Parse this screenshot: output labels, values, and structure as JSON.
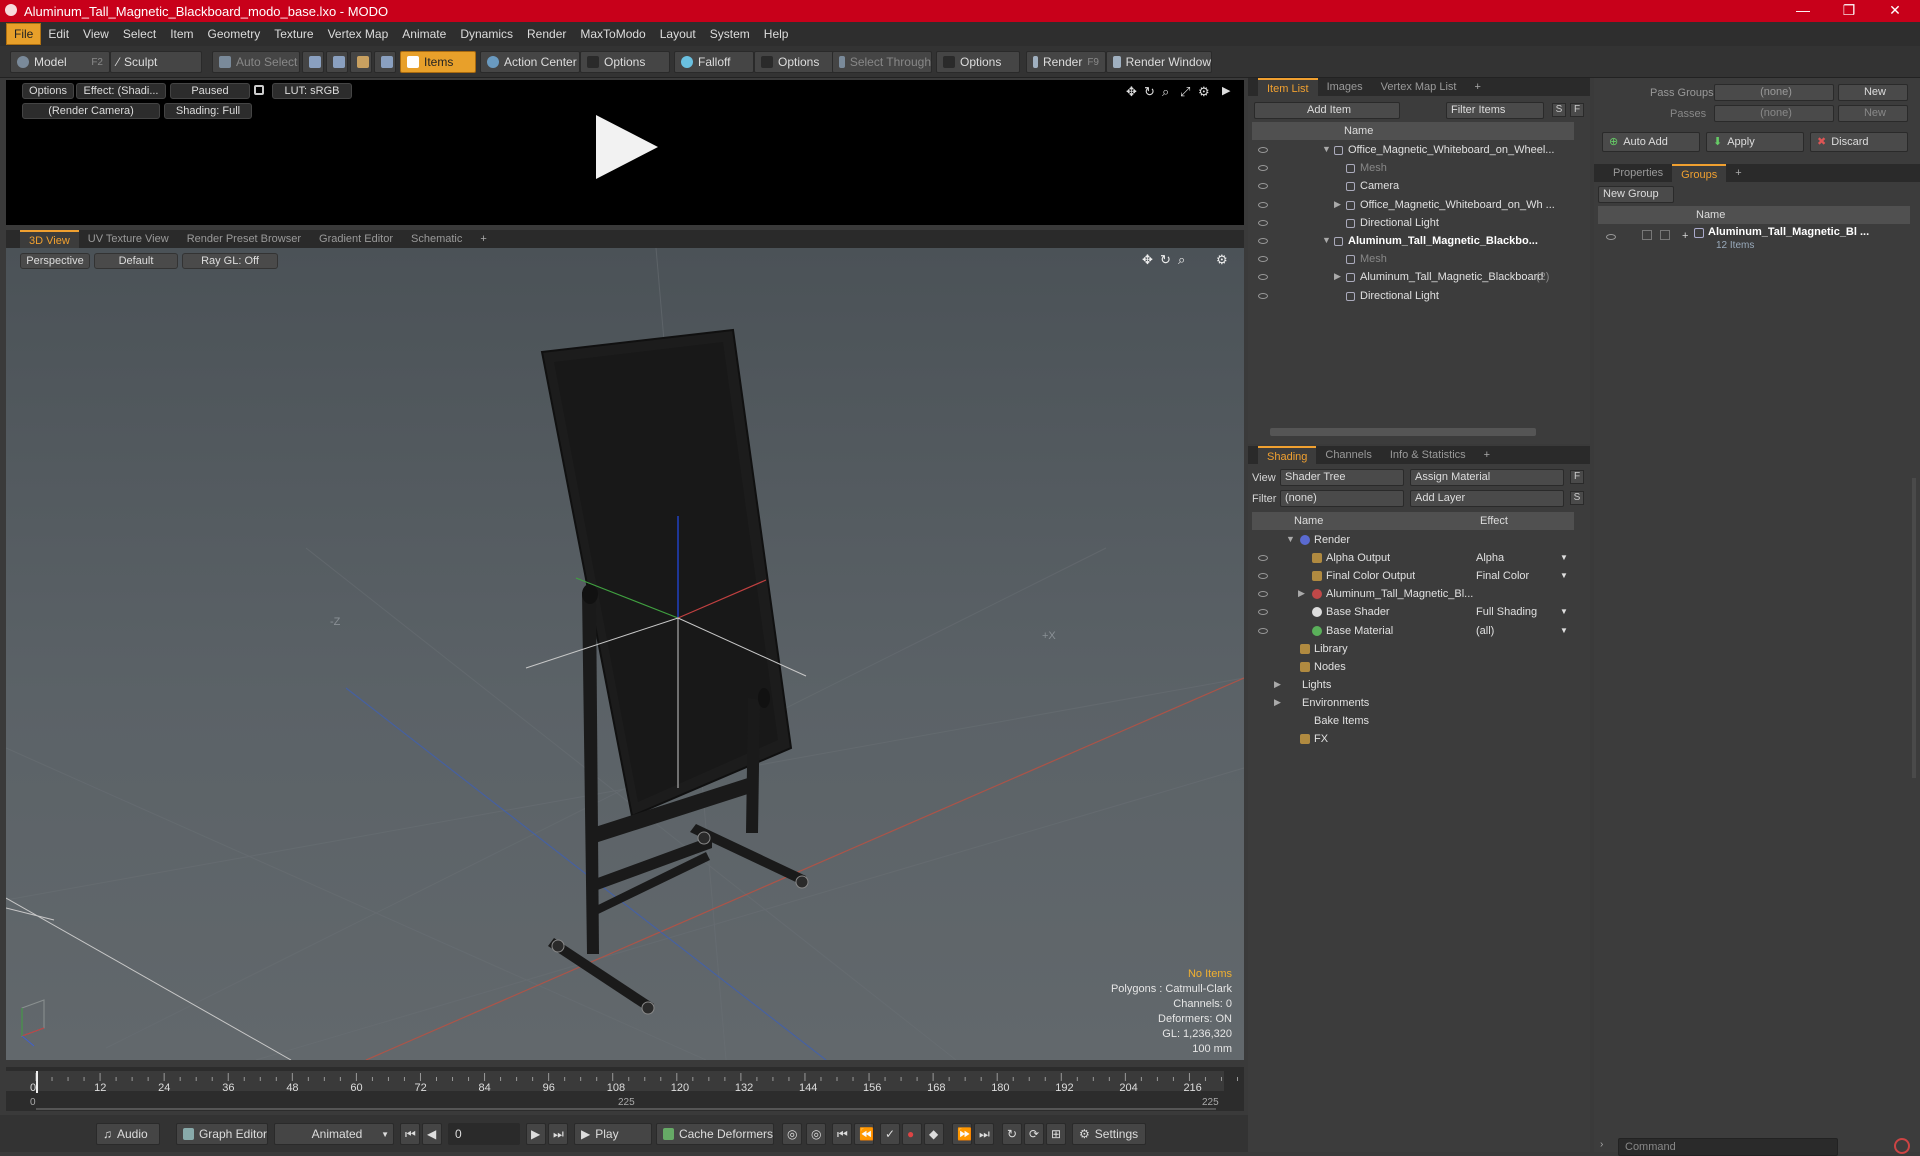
{
  "window": {
    "title": "Aluminum_Tall_Magnetic_Blackboard_modo_base.lxo - MODO",
    "minimize": "—",
    "maximize": "❐",
    "close": "✕"
  },
  "menu": [
    "File",
    "Edit",
    "View",
    "Select",
    "Item",
    "Geometry",
    "Texture",
    "Vertex Map",
    "Animate",
    "Dynamics",
    "Render",
    "MaxToModo",
    "Layout",
    "System",
    "Help"
  ],
  "toolbar": {
    "model": "Model",
    "model_key": "F2",
    "sculpt": "Sculpt",
    "auto_select": "Auto Select",
    "items": "Items",
    "action_center": "Action Center",
    "options1": "Options",
    "falloff": "Falloff",
    "options2": "Options",
    "select_through": "Select Through",
    "options3": "Options",
    "render": "Render",
    "render_key": "F9",
    "render_window": "Render Window"
  },
  "preview": {
    "options": "Options",
    "effect": "Effect: (Shadi...",
    "paused": "Paused",
    "lut": "LUT: sRGB",
    "camera": "(Render Camera)",
    "shading": "Shading: Full"
  },
  "viewport_tabs": [
    "3D View",
    "UV Texture View",
    "Render Preset Browser",
    "Gradient Editor",
    "Schematic",
    "+"
  ],
  "viewport": {
    "perspective": "Perspective",
    "default": "Default",
    "raygl": "Ray GL: Off",
    "axis_minus_z": "-Z",
    "axis_plus_x": "+X",
    "hud": {
      "no_items": "No Items",
      "polygons": "Polygons : Catmull-Clark",
      "channels": "Channels: 0",
      "deformers": "Deformers: ON",
      "gl": "GL: 1,236,320",
      "scale": "100 mm"
    }
  },
  "timeline": {
    "ticks": [
      "0",
      "12",
      "24",
      "36",
      "48",
      "60",
      "72",
      "84",
      "96",
      "108",
      "120",
      "132",
      "144",
      "156",
      "168",
      "180",
      "192",
      "204",
      "216"
    ],
    "sub_left": "0",
    "sub_mid": "225",
    "sub_right": "225"
  },
  "transport": {
    "audio": "Audio",
    "graph_editor": "Graph Editor",
    "animated": "Animated",
    "frame": "0",
    "play": "Play",
    "cache_deformers": "Cache Deformers",
    "settings": "Settings"
  },
  "item_list": {
    "tabs": [
      "Item List",
      "Images",
      "Vertex Map List",
      "+"
    ],
    "add_item": "Add Item",
    "filter_items": "Filter Items",
    "s": "S",
    "f": "F",
    "name_header": "Name",
    "rows": [
      {
        "label": "Office_Magnetic_Whiteboard_on_Wheel...",
        "style": "normal"
      },
      {
        "label": "Mesh",
        "style": "gray"
      },
      {
        "label": "Camera",
        "style": "normal"
      },
      {
        "label": "Office_Magnetic_Whiteboard_on_Wh ...",
        "style": "normal"
      },
      {
        "label": "Directional Light",
        "style": "normal"
      },
      {
        "label": "Aluminum_Tall_Magnetic_Blackbo...",
        "style": "bold"
      },
      {
        "label": "Mesh",
        "style": "gray"
      },
      {
        "label": "Aluminum_Tall_Magnetic_Blackboard",
        "style": "normal",
        "suffix": "(2)"
      },
      {
        "label": "Directional Light",
        "style": "normal"
      }
    ]
  },
  "shading": {
    "tabs": [
      "Shading",
      "Channels",
      "Info & Statistics",
      "+"
    ],
    "view_label": "View",
    "view_value": "Shader Tree",
    "assign_material": "Assign Material",
    "filter_label": "Filter",
    "filter_value": "(none)",
    "add_layer": "Add Layer",
    "f": "F",
    "s": "S",
    "name_header": "Name",
    "effect_header": "Effect",
    "rows": [
      {
        "label": "Render",
        "effect": ""
      },
      {
        "label": "Alpha Output",
        "effect": "Alpha"
      },
      {
        "label": "Final Color Output",
        "effect": "Final Color"
      },
      {
        "label": "Aluminum_Tall_Magnetic_Bl...",
        "effect": ""
      },
      {
        "label": "Base Shader",
        "effect": "Full Shading"
      },
      {
        "label": "Base Material",
        "effect": "(all)"
      },
      {
        "label": "Library",
        "effect": ""
      },
      {
        "label": "Nodes",
        "effect": ""
      },
      {
        "label": "Lights",
        "effect": ""
      },
      {
        "label": "Environments",
        "effect": ""
      },
      {
        "label": "Bake Items",
        "effect": ""
      },
      {
        "label": "FX",
        "effect": ""
      }
    ]
  },
  "groups": {
    "pass_groups_label": "Pass Groups",
    "pass_groups_value": "(none)",
    "new": "New",
    "passes_label": "Passes",
    "passes_value": "(none)",
    "new2": "New",
    "auto_add": "Auto Add",
    "apply": "Apply",
    "discard": "Discard",
    "tabs": [
      "Properties",
      "Groups",
      "+"
    ],
    "new_group": "New Group",
    "name_header": "Name",
    "group_name": "Aluminum_Tall_Magnetic_Bl ...",
    "group_count": "12 Items",
    "command_placeholder": "Command"
  }
}
